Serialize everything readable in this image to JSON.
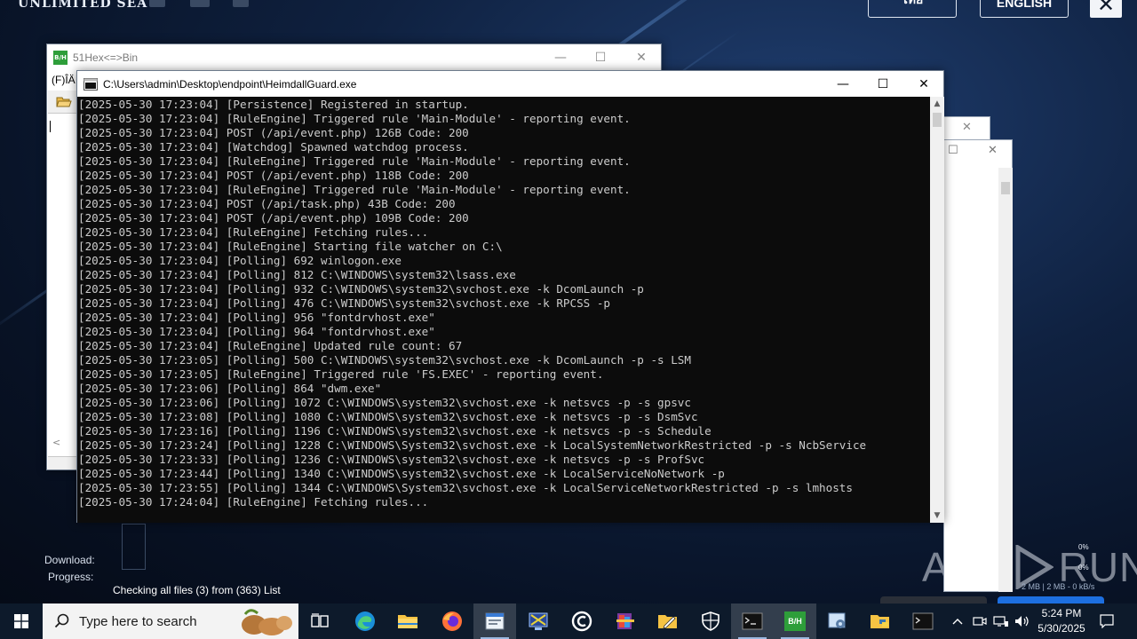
{
  "desktop": {
    "app_logo": "UNLIMITED SEA",
    "lang_thai": "ไทย",
    "lang_english": "ENGLISH",
    "close_glyph": "✕",
    "download_label": "Download:",
    "progress_label": "Progress:",
    "status_text": "Checking all files (3) from (363) List",
    "percent_1": "0%",
    "percent_2": "0%",
    "speed_text": "2 MB | 2 MB - 0 kB/s",
    "watermark_left": "ANY",
    "watermark_right": "RUN"
  },
  "hex_window": {
    "title": "51Hex<=>Bin",
    "menu_text": "(F)ÎÄ",
    "icon_label": "B/H"
  },
  "console_window": {
    "title": "C:\\Users\\admin\\Desktop\\endpoint\\HeimdallGuard.exe",
    "lines": [
      "[2025-05-30 17:23:04] [Persistence] Registered in startup.",
      "[2025-05-30 17:23:04] [RuleEngine] Triggered rule 'Main-Module' - reporting event.",
      "[2025-05-30 17:23:04] POST (/api/event.php) 126B Code: 200",
      "[2025-05-30 17:23:04] [Watchdog] Spawned watchdog process.",
      "[2025-05-30 17:23:04] [RuleEngine] Triggered rule 'Main-Module' - reporting event.",
      "[2025-05-30 17:23:04] POST (/api/event.php) 118B Code: 200",
      "[2025-05-30 17:23:04] [RuleEngine] Triggered rule 'Main-Module' - reporting event.",
      "[2025-05-30 17:23:04] POST (/api/task.php) 43B Code: 200",
      "[2025-05-30 17:23:04] POST (/api/event.php) 109B Code: 200",
      "[2025-05-30 17:23:04] [RuleEngine] Fetching rules...",
      "[2025-05-30 17:23:04] [RuleEngine] Starting file watcher on C:\\",
      "[2025-05-30 17:23:04] [Polling] 692 winlogon.exe",
      "[2025-05-30 17:23:04] [Polling] 812 C:\\WINDOWS\\system32\\lsass.exe",
      "[2025-05-30 17:23:04] [Polling] 932 C:\\WINDOWS\\system32\\svchost.exe -k DcomLaunch -p",
      "[2025-05-30 17:23:04] [Polling] 476 C:\\WINDOWS\\system32\\svchost.exe -k RPCSS -p",
      "[2025-05-30 17:23:04] [Polling] 956 \"fontdrvhost.exe\"",
      "[2025-05-30 17:23:04] [Polling] 964 \"fontdrvhost.exe\"",
      "[2025-05-30 17:23:04] [RuleEngine] Updated rule count: 67",
      "[2025-05-30 17:23:05] [Polling] 500 C:\\WINDOWS\\system32\\svchost.exe -k DcomLaunch -p -s LSM",
      "[2025-05-30 17:23:05] [RuleEngine] Triggered rule 'FS.EXEC' - reporting event.",
      "[2025-05-30 17:23:06] [Polling] 864 \"dwm.exe\"",
      "[2025-05-30 17:23:06] [Polling] 1072 C:\\WINDOWS\\system32\\svchost.exe -k netsvcs -p -s gpsvc",
      "[2025-05-30 17:23:08] [Polling] 1080 C:\\WINDOWS\\system32\\svchost.exe -k netsvcs -p -s DsmSvc",
      "[2025-05-30 17:23:16] [Polling] 1196 C:\\WINDOWS\\system32\\svchost.exe -k netsvcs -p -s Schedule",
      "[2025-05-30 17:23:24] [Polling] 1228 C:\\WINDOWS\\System32\\svchost.exe -k LocalSystemNetworkRestricted -p -s NcbService",
      "[2025-05-30 17:23:33] [Polling] 1236 C:\\WINDOWS\\system32\\svchost.exe -k netsvcs -p -s ProfSvc",
      "[2025-05-30 17:23:44] [Polling] 1340 C:\\WINDOWS\\system32\\svchost.exe -k LocalServiceNoNetwork -p",
      "[2025-05-30 17:23:55] [Polling] 1344 C:\\WINDOWS\\System32\\svchost.exe -k LocalServiceNetworkRestricted -p -s lmhosts",
      "[2025-05-30 17:24:04] [RuleEngine] Fetching rules..."
    ]
  },
  "caption": {
    "minimize": "—",
    "maximize": "☐",
    "close": "✕"
  },
  "taskbar": {
    "search_placeholder": "Type here to search",
    "time": "5:24 PM",
    "date": "5/30/2025",
    "hex_icon_label": "B/H"
  },
  "icons": {
    "start": "windows-logo-icon",
    "task_view": "task-view-icon",
    "edge": "edge-icon",
    "explorer": "file-explorer-icon",
    "firefox": "firefox-icon"
  }
}
